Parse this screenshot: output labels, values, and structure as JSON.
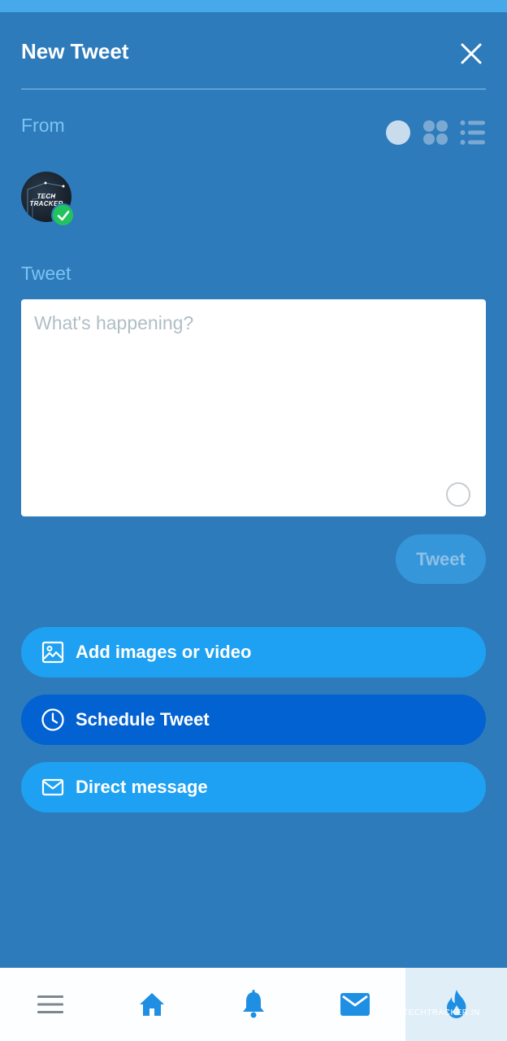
{
  "header": {
    "title": "New Tweet",
    "close_icon": "close-icon"
  },
  "from": {
    "label": "From",
    "view_toggles": [
      "single-circle-icon",
      "grid-icon",
      "list-icon"
    ],
    "account": {
      "avatar_text": "TECH TRACKER",
      "verified_icon": "checkmark-icon"
    }
  },
  "composer": {
    "label": "Tweet",
    "placeholder": "What's happening?",
    "value": "",
    "submit_label": "Tweet"
  },
  "actions": [
    {
      "label": "Add images or video",
      "icon": "image-icon"
    },
    {
      "label": "Schedule Tweet",
      "icon": "clock-icon"
    },
    {
      "label": "Direct message",
      "icon": "mail-icon"
    }
  ],
  "bottom_nav": {
    "items": [
      "menu-icon",
      "home-icon",
      "bell-icon",
      "mail-icon",
      "flame-icon"
    ],
    "active_index": 4
  },
  "watermark": {
    "text": "TECHTRACKER.IN"
  },
  "colors": {
    "background": "#2e7bbb",
    "accent": "#1ea1f2",
    "schedule": "#0262d2",
    "verified": "#22c35e"
  }
}
